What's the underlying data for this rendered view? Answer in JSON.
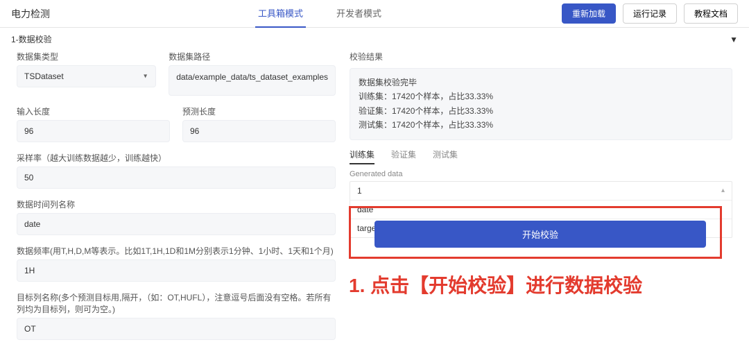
{
  "header": {
    "title": "电力检测",
    "tabs": [
      "工具箱模式",
      "开发者模式"
    ],
    "active_tab_index": 0,
    "buttons": {
      "reload": "重新加载",
      "run_log": "运行记录",
      "docs": "教程文档"
    }
  },
  "section": {
    "title": "1-数据校验"
  },
  "left": {
    "dataset_type_label": "数据集类型",
    "dataset_type_value": "TSDataset",
    "dataset_path_label": "数据集路径",
    "dataset_path_value": "data/example_data/ts_dataset_examples",
    "input_len_label": "输入长度",
    "input_len_value": "96",
    "predict_len_label": "预测长度",
    "predict_len_value": "96",
    "sample_rate_label": "采样率（越大训练数据越少，训练越快）",
    "sample_rate_value": "50",
    "time_col_label": "数据时间列名称",
    "time_col_value": "date",
    "freq_label": "数据频率(用T,H,D,M等表示。比如1T,1H,1D和1M分别表示1分钟、1小时、1天和1个月)",
    "freq_value": "1H",
    "target_col_label": "目标列名称(多个预测目标用,隔开，（如：OT,HUFL），注意逗号后面没有空格。若所有列均为目标列，则可为空。)",
    "target_col_value": "OT"
  },
  "right": {
    "result_title": "校验结果",
    "result_lines": [
      "数据集校验完毕",
      "训练集：17420个样本，占比33.33%",
      "验证集：17420个样本，占比33.33%",
      "测试集：17420个样本，占比33.33%"
    ],
    "data_tabs": [
      "训练集",
      "验证集",
      "测试集"
    ],
    "data_tab_active": 0,
    "generated_label": "Generated data",
    "rows": [
      "1",
      "date",
      "target"
    ],
    "start_button": "开始校验"
  },
  "callout": "1. 点击【开始校验】进行数据校验"
}
